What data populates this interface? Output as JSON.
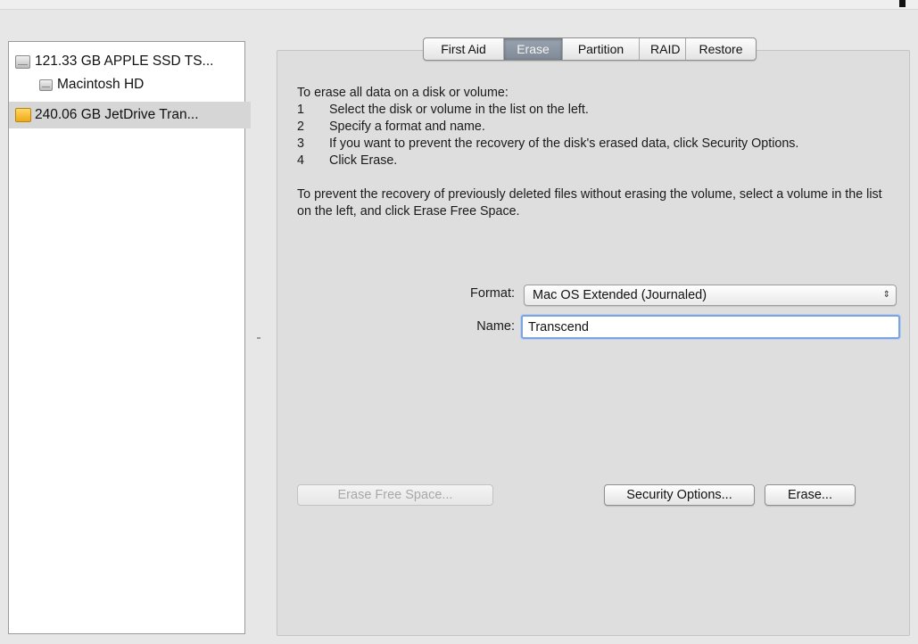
{
  "sidebar": {
    "items": [
      {
        "label": "121.33 GB APPLE SSD TS...",
        "icon": "internal-disk-icon"
      },
      {
        "label": "Macintosh HD",
        "icon": "volume-icon"
      },
      {
        "label": "240.06 GB JetDrive Tran...",
        "icon": "external-drive-icon",
        "selected": true
      }
    ]
  },
  "tabs": [
    {
      "label": "First Aid"
    },
    {
      "label": "Erase",
      "active": true
    },
    {
      "label": "Partition"
    },
    {
      "label": "RAID"
    },
    {
      "label": "Restore"
    }
  ],
  "instructions": {
    "intro": "To erase all data on a disk or volume:",
    "steps": [
      {
        "num": "1",
        "text": "Select the disk or volume in the list on the left."
      },
      {
        "num": "2",
        "text": "Specify a format and name."
      },
      {
        "num": "3",
        "text": "If you want to prevent the recovery of the disk's erased data, click Security Options."
      },
      {
        "num": "4",
        "text": "Click Erase."
      }
    ],
    "paragraph2": "To prevent the recovery of previously deleted files without erasing the volume, select a volume in the list on the left, and click Erase Free Space."
  },
  "form": {
    "format_label": "Format:",
    "format_value": "Mac OS Extended (Journaled)",
    "name_label": "Name:",
    "name_value": "Transcend"
  },
  "buttons": {
    "erase_free_space": "Erase Free Space...",
    "security_options": "Security Options...",
    "erase": "Erase..."
  },
  "colors": {
    "selected_row": "#d6d6d6",
    "active_tab": "#8893a0",
    "input_focus": "#7ea4e0"
  }
}
